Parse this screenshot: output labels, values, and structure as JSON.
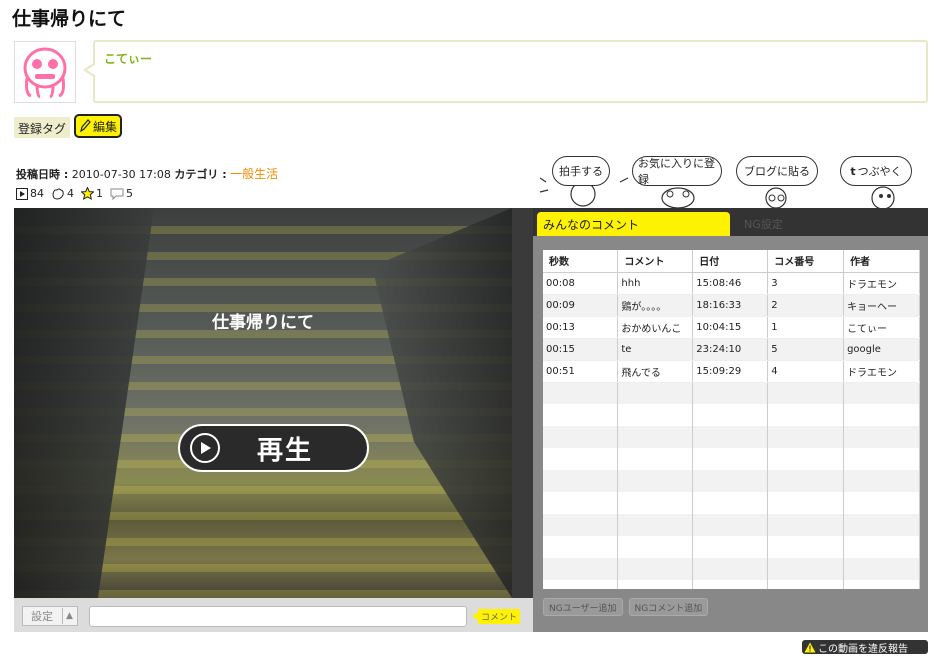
{
  "page": {
    "title": "仕事帰りにて"
  },
  "user": {
    "name": "こてぃー"
  },
  "tags": {
    "label": "登録タグ",
    "edit_label": "編集"
  },
  "meta": {
    "posted_label": "投稿日時 :",
    "posted_value": "2010-07-30 17:08",
    "category_label": "カテゴリ :",
    "category_value": "一般生活"
  },
  "stats": {
    "plays": "84",
    "claps": "4",
    "favorites": "1",
    "comments": "5"
  },
  "actions": {
    "clap": "拍手する",
    "favorite": "お気に入りに登録",
    "blog": "ブログに貼る",
    "tweet": "つぶやく"
  },
  "video": {
    "title": "仕事帰りにて",
    "play_label": "再生"
  },
  "player_bar": {
    "settings_label": "設定",
    "comment_button": "コメント"
  },
  "panel": {
    "tab_all": "みんなのコメント",
    "tab_ng": "NG設定",
    "columns": [
      "秒数",
      "コメント",
      "日付",
      "コメ番号",
      "作者"
    ],
    "rows": [
      [
        "00:08",
        "hhh",
        "15:08:46",
        "3",
        "ドラエモン"
      ],
      [
        "00:09",
        "鶏が。。。。",
        "18:16:33",
        "2",
        "キョーヘー"
      ],
      [
        "00:13",
        "おかめいんこ",
        "10:04:15",
        "1",
        "こてぃー"
      ],
      [
        "00:15",
        "te",
        "23:24:10",
        "5",
        "google"
      ],
      [
        "00:51",
        "飛んでる",
        "15:09:29",
        "4",
        "ドラエモン"
      ]
    ],
    "ng_user_button": "NGユーザー追加",
    "ng_comment_button": "NGコメント追加"
  },
  "report": {
    "label": "この動画を違反報告"
  },
  "colors": {
    "accent_yellow": "#fff200",
    "username_green": "#7fb416",
    "category_orange": "#f08c00"
  }
}
